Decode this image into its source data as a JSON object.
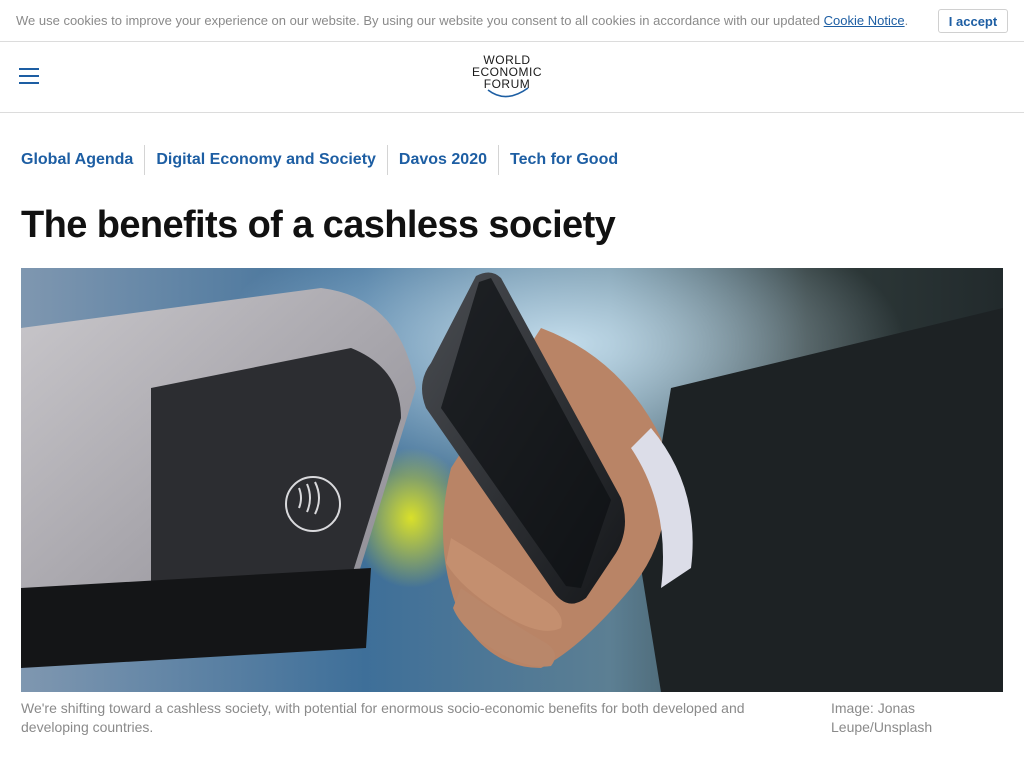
{
  "cookie_bar": {
    "message": "We use cookies to improve your experience on our website. By using our website you consent to all cookies in accordance with our updated",
    "link_label": "Cookie Notice",
    "suffix": ".",
    "accept_label": "I accept"
  },
  "header": {
    "logo_lines": [
      "WORLD",
      "ECONOMIC",
      "FORUM"
    ],
    "menu_icon": "hamburger-icon"
  },
  "topics": [
    "Global Agenda",
    "Digital Economy and Society",
    "Davos 2020",
    "Tech for Good"
  ],
  "article": {
    "title": "The benefits of a cashless society",
    "image_caption": "We're shifting toward a cashless society, with potential for enormous socio-economic benefits for both developed and developing countries.",
    "image_credit": "Image: Jonas Leupe/Unsplash"
  },
  "colors": {
    "accent": "#1d5ea3",
    "muted_text": "#8a8a8a",
    "divider": "#dcdcdc"
  }
}
